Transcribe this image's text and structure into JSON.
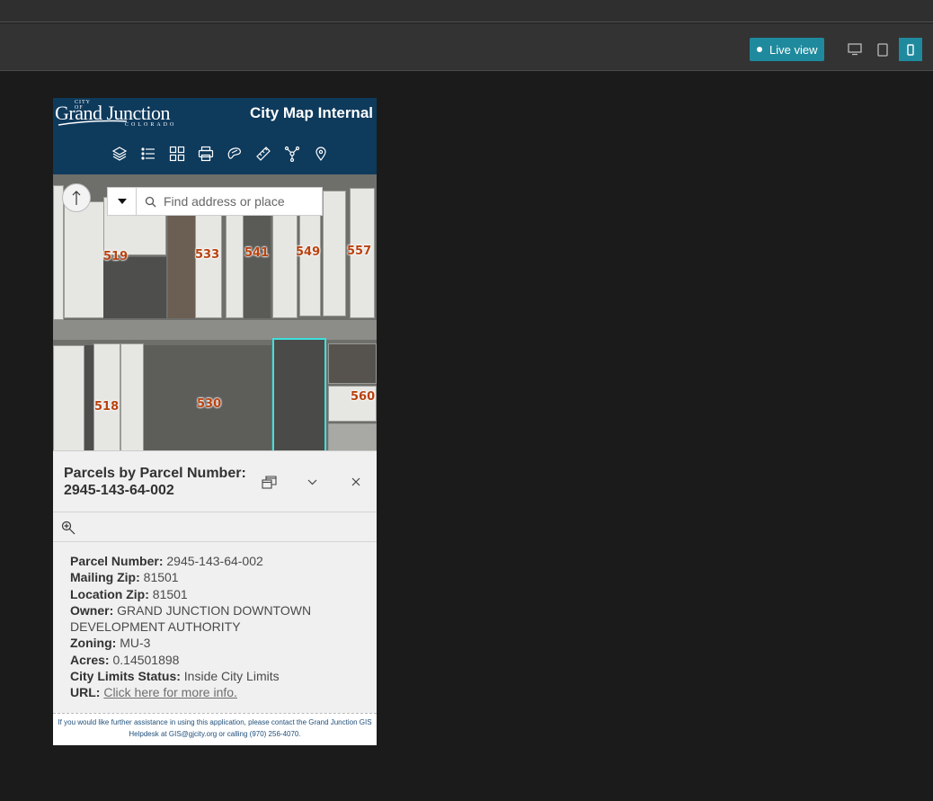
{
  "toolbar": {
    "live_view_label": "Live view",
    "devices": [
      {
        "name": "desktop",
        "active": false
      },
      {
        "name": "tablet",
        "active": false
      },
      {
        "name": "phone",
        "active": true
      }
    ]
  },
  "app": {
    "logo": {
      "city_of": "CITY OF",
      "name": "Grand Junction",
      "state": "COLORADO"
    },
    "title": "City Map Internal",
    "tools": [
      "layers-icon",
      "legend-icon",
      "basemap-gallery-icon",
      "print-icon",
      "draw-icon",
      "measure-icon",
      "share-icon",
      "location-icon"
    ]
  },
  "map": {
    "search_placeholder": "Find address or place",
    "labels": [
      "519",
      "533",
      "541",
      "549",
      "557",
      "518",
      "530",
      "560"
    ],
    "highlight_color": "#3ee0dc",
    "label_color": "#b8420f"
  },
  "popup": {
    "title": "Parcels by Parcel Number: 2945-143-64-002",
    "fields": [
      {
        "label": "Parcel Number:",
        "value": "2945-143-64-002"
      },
      {
        "label": "Mailing Zip:",
        "value": "81501"
      },
      {
        "label": "Location Zip:",
        "value": "81501"
      },
      {
        "label": "Owner:",
        "value": "GRAND JUNCTION DOWNTOWN DEVELOPMENT AUTHORITY"
      },
      {
        "label": "Zoning:",
        "value": "MU-3"
      },
      {
        "label": "Acres:",
        "value": "0.14501898"
      },
      {
        "label": "City Limits Status:",
        "value": "Inside City Limits"
      },
      {
        "label": "URL:",
        "link_text": "Click here for more info."
      }
    ]
  },
  "footer": {
    "line1": "If you would like further assistance in using this application, please contact the Grand Junction GIS",
    "line2": "Helpdesk at GIS@gjcity.org or calling (970) 256-4070."
  },
  "colors": {
    "header_bg": "#0e3a5c",
    "accent": "#1f8a9e"
  }
}
